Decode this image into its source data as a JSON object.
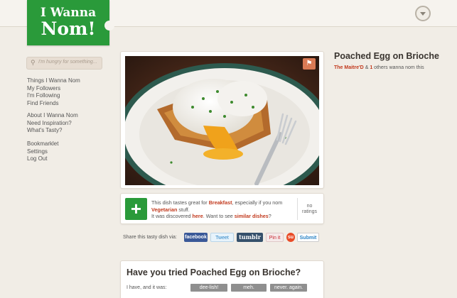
{
  "logo": {
    "line1": "I Wanna",
    "line2": "Nom!"
  },
  "search": {
    "placeholder": "I'm hungry for something..."
  },
  "sidebar": {
    "group1": [
      "Things I Wanna Nom",
      "My Followers",
      "I'm Following",
      "Find Friends"
    ],
    "group2": [
      "About I Wanna Nom",
      "Need Inspiration?",
      "What's Tasty?"
    ],
    "group3": [
      "Bookmarklet",
      "Settings",
      "Log Out"
    ]
  },
  "dish": {
    "title": "Poached Egg on Brioche",
    "noms": {
      "user": "The Maitre'D",
      "amp": "&",
      "count": "1",
      "suffix": "others wanna nom this"
    }
  },
  "taste": {
    "t1": "This dish tastes great for ",
    "meal": "Breakfast",
    "t2": ", especially if you nom",
    "diet": "Vegetarian",
    "t3": " stuff.",
    "t4": "It was discovered ",
    "here": "here",
    "t5": ". Want to see ",
    "similar": "similar dishes",
    "t6": "?",
    "ratings_line1": "no",
    "ratings_line2": "ratings"
  },
  "share": {
    "label": "Share this tasty dish via:",
    "facebook": "facebook",
    "tweet": "Tweet",
    "tumblr": "tumblr",
    "pinit": "Pin it",
    "stumble": "su",
    "submit": "Submit"
  },
  "question": {
    "title": "Have you tried Poached Egg on Brioche?",
    "label": "I have, and it was:",
    "options": [
      "dee-lish!",
      "meh.",
      "never. again."
    ]
  },
  "colors": {
    "brand_green": "#2a9a3a",
    "accent_red": "#c23a1e",
    "background": "#f1ede6"
  }
}
